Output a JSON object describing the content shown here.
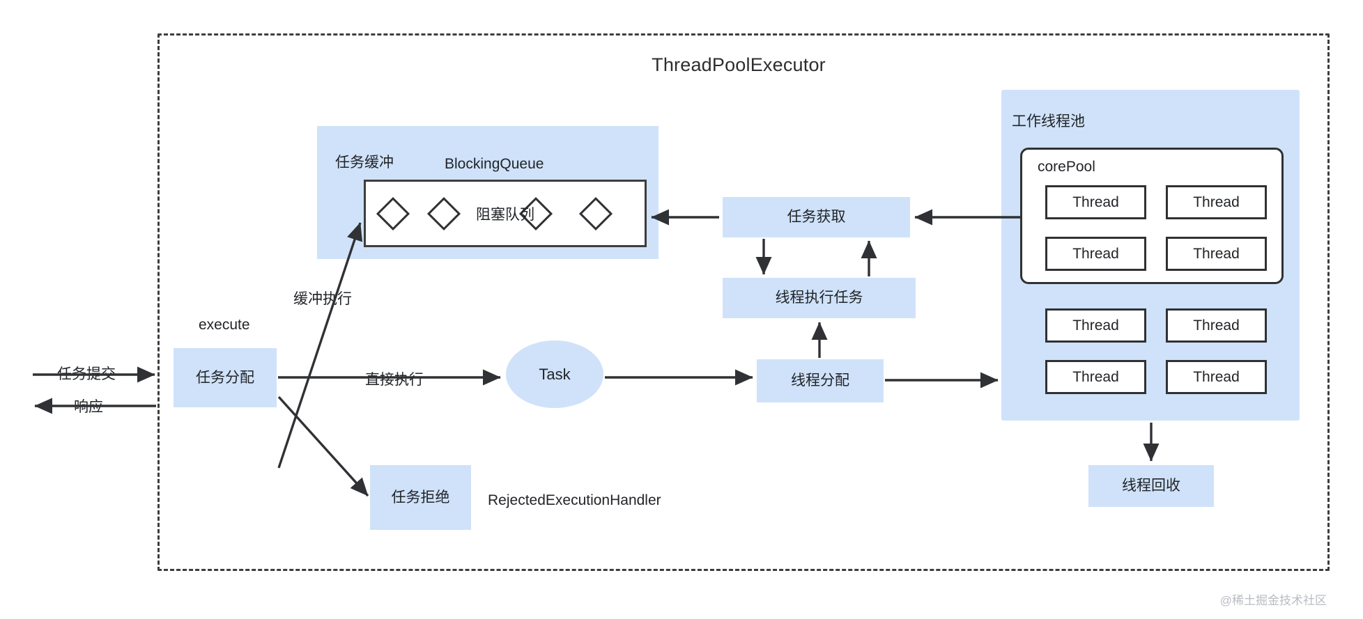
{
  "diagram": {
    "title": "ThreadPoolExecutor",
    "watermark": "@稀土掘金技术社区",
    "colors": {
      "fill_blue": "#cfe2fa",
      "stroke_dark": "#2f3134",
      "dashed_border": "#3d3d3d",
      "background": "#ffffff",
      "watermark": "#b9bcc2"
    }
  },
  "entry": {
    "submit_label": "任务提交",
    "response_label": "响应",
    "execute_label": "execute",
    "dispatch_box": "任务分配"
  },
  "buffer": {
    "panel_label": "任务缓冲",
    "queue_type_label": "BlockingQueue",
    "queue_inner_label": "阻塞队列",
    "diamond_count": 4
  },
  "edges": {
    "buffered_execute": "缓冲执行",
    "direct_execute": "直接执行"
  },
  "task": {
    "label": "Task"
  },
  "reject": {
    "box_label": "任务拒绝",
    "handler_label": "RejectedExecutionHandler"
  },
  "middle_boxes": {
    "fetch_task": "任务获取",
    "thread_run_task": "线程执行任务",
    "thread_dispatch": "线程分配"
  },
  "pool": {
    "panel_title": "工作线程池",
    "core_pool_title": "corePool",
    "core_threads": [
      "Thread",
      "Thread",
      "Thread",
      "Thread"
    ],
    "extra_threads": [
      "Thread",
      "Thread",
      "Thread",
      "Thread"
    ],
    "recycle_box": "线程回收"
  }
}
